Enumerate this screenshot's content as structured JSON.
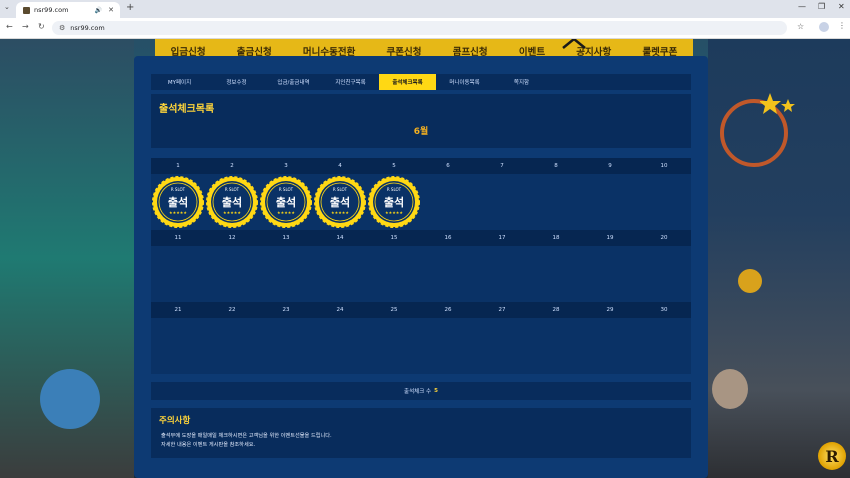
{
  "browser": {
    "tab_title": "nsr99.com",
    "url": "nsr99.com"
  },
  "nav": [
    "입금신청",
    "출금신청",
    "머니수동전환",
    "쿠폰신청",
    "콤프신청",
    "이벤트",
    "공지사항",
    "룰렛쿠폰"
  ],
  "subtabs": [
    {
      "label": "MY페이지",
      "active": false
    },
    {
      "label": "정보수정",
      "active": false
    },
    {
      "label": "입금/출금내역",
      "active": false
    },
    {
      "label": "지인친구목록",
      "active": false
    },
    {
      "label": "출석체크목록",
      "active": true
    },
    {
      "label": "머니이동목록",
      "active": false
    },
    {
      "label": "쪽지함",
      "active": false
    }
  ],
  "section_title": "출석체크목록",
  "month": "6월",
  "calendar": {
    "weeks": [
      [
        "1",
        "2",
        "3",
        "4",
        "5",
        "6",
        "7",
        "8",
        "9",
        "10"
      ],
      [
        "11",
        "12",
        "13",
        "14",
        "15",
        "16",
        "17",
        "18",
        "19",
        "20"
      ],
      [
        "21",
        "22",
        "23",
        "24",
        "25",
        "26",
        "27",
        "28",
        "29",
        "30"
      ]
    ],
    "attended": [
      "1",
      "2",
      "3",
      "4",
      "5"
    ]
  },
  "stamp": {
    "brand": "R SLOT",
    "text": "출석",
    "stars": "★★★★★"
  },
  "count": {
    "label": "출석체크 수",
    "value": "5"
  },
  "notice": {
    "title": "주의사항",
    "line1": "출석부에 도장을 매일매일 체크하시면은 고객님을 위한 이벤트선물을 드립니다.",
    "line2": "자세한 내용은 이벤트 게시판을 참조하세요."
  },
  "logo_letter": "R",
  "colors": {
    "accent": "#ffd814",
    "panel": "#0d3a73",
    "nav": "#e6b817"
  }
}
